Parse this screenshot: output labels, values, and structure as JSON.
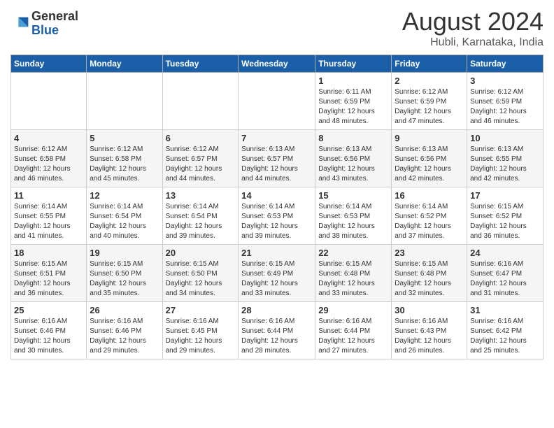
{
  "header": {
    "logo_general": "General",
    "logo_blue": "Blue",
    "month_year": "August 2024",
    "location": "Hubli, Karnataka, India"
  },
  "days_of_week": [
    "Sunday",
    "Monday",
    "Tuesday",
    "Wednesday",
    "Thursday",
    "Friday",
    "Saturday"
  ],
  "weeks": [
    [
      {
        "num": "",
        "info": ""
      },
      {
        "num": "",
        "info": ""
      },
      {
        "num": "",
        "info": ""
      },
      {
        "num": "",
        "info": ""
      },
      {
        "num": "1",
        "info": "Sunrise: 6:11 AM\nSunset: 6:59 PM\nDaylight: 12 hours\nand 48 minutes."
      },
      {
        "num": "2",
        "info": "Sunrise: 6:12 AM\nSunset: 6:59 PM\nDaylight: 12 hours\nand 47 minutes."
      },
      {
        "num": "3",
        "info": "Sunrise: 6:12 AM\nSunset: 6:59 PM\nDaylight: 12 hours\nand 46 minutes."
      }
    ],
    [
      {
        "num": "4",
        "info": "Sunrise: 6:12 AM\nSunset: 6:58 PM\nDaylight: 12 hours\nand 46 minutes."
      },
      {
        "num": "5",
        "info": "Sunrise: 6:12 AM\nSunset: 6:58 PM\nDaylight: 12 hours\nand 45 minutes."
      },
      {
        "num": "6",
        "info": "Sunrise: 6:12 AM\nSunset: 6:57 PM\nDaylight: 12 hours\nand 44 minutes."
      },
      {
        "num": "7",
        "info": "Sunrise: 6:13 AM\nSunset: 6:57 PM\nDaylight: 12 hours\nand 44 minutes."
      },
      {
        "num": "8",
        "info": "Sunrise: 6:13 AM\nSunset: 6:56 PM\nDaylight: 12 hours\nand 43 minutes."
      },
      {
        "num": "9",
        "info": "Sunrise: 6:13 AM\nSunset: 6:56 PM\nDaylight: 12 hours\nand 42 minutes."
      },
      {
        "num": "10",
        "info": "Sunrise: 6:13 AM\nSunset: 6:55 PM\nDaylight: 12 hours\nand 42 minutes."
      }
    ],
    [
      {
        "num": "11",
        "info": "Sunrise: 6:14 AM\nSunset: 6:55 PM\nDaylight: 12 hours\nand 41 minutes."
      },
      {
        "num": "12",
        "info": "Sunrise: 6:14 AM\nSunset: 6:54 PM\nDaylight: 12 hours\nand 40 minutes."
      },
      {
        "num": "13",
        "info": "Sunrise: 6:14 AM\nSunset: 6:54 PM\nDaylight: 12 hours\nand 39 minutes."
      },
      {
        "num": "14",
        "info": "Sunrise: 6:14 AM\nSunset: 6:53 PM\nDaylight: 12 hours\nand 39 minutes."
      },
      {
        "num": "15",
        "info": "Sunrise: 6:14 AM\nSunset: 6:53 PM\nDaylight: 12 hours\nand 38 minutes."
      },
      {
        "num": "16",
        "info": "Sunrise: 6:14 AM\nSunset: 6:52 PM\nDaylight: 12 hours\nand 37 minutes."
      },
      {
        "num": "17",
        "info": "Sunrise: 6:15 AM\nSunset: 6:52 PM\nDaylight: 12 hours\nand 36 minutes."
      }
    ],
    [
      {
        "num": "18",
        "info": "Sunrise: 6:15 AM\nSunset: 6:51 PM\nDaylight: 12 hours\nand 36 minutes."
      },
      {
        "num": "19",
        "info": "Sunrise: 6:15 AM\nSunset: 6:50 PM\nDaylight: 12 hours\nand 35 minutes."
      },
      {
        "num": "20",
        "info": "Sunrise: 6:15 AM\nSunset: 6:50 PM\nDaylight: 12 hours\nand 34 minutes."
      },
      {
        "num": "21",
        "info": "Sunrise: 6:15 AM\nSunset: 6:49 PM\nDaylight: 12 hours\nand 33 minutes."
      },
      {
        "num": "22",
        "info": "Sunrise: 6:15 AM\nSunset: 6:48 PM\nDaylight: 12 hours\nand 33 minutes."
      },
      {
        "num": "23",
        "info": "Sunrise: 6:15 AM\nSunset: 6:48 PM\nDaylight: 12 hours\nand 32 minutes."
      },
      {
        "num": "24",
        "info": "Sunrise: 6:16 AM\nSunset: 6:47 PM\nDaylight: 12 hours\nand 31 minutes."
      }
    ],
    [
      {
        "num": "25",
        "info": "Sunrise: 6:16 AM\nSunset: 6:46 PM\nDaylight: 12 hours\nand 30 minutes."
      },
      {
        "num": "26",
        "info": "Sunrise: 6:16 AM\nSunset: 6:46 PM\nDaylight: 12 hours\nand 29 minutes."
      },
      {
        "num": "27",
        "info": "Sunrise: 6:16 AM\nSunset: 6:45 PM\nDaylight: 12 hours\nand 29 minutes."
      },
      {
        "num": "28",
        "info": "Sunrise: 6:16 AM\nSunset: 6:44 PM\nDaylight: 12 hours\nand 28 minutes."
      },
      {
        "num": "29",
        "info": "Sunrise: 6:16 AM\nSunset: 6:44 PM\nDaylight: 12 hours\nand 27 minutes."
      },
      {
        "num": "30",
        "info": "Sunrise: 6:16 AM\nSunset: 6:43 PM\nDaylight: 12 hours\nand 26 minutes."
      },
      {
        "num": "31",
        "info": "Sunrise: 6:16 AM\nSunset: 6:42 PM\nDaylight: 12 hours\nand 25 minutes."
      }
    ]
  ]
}
